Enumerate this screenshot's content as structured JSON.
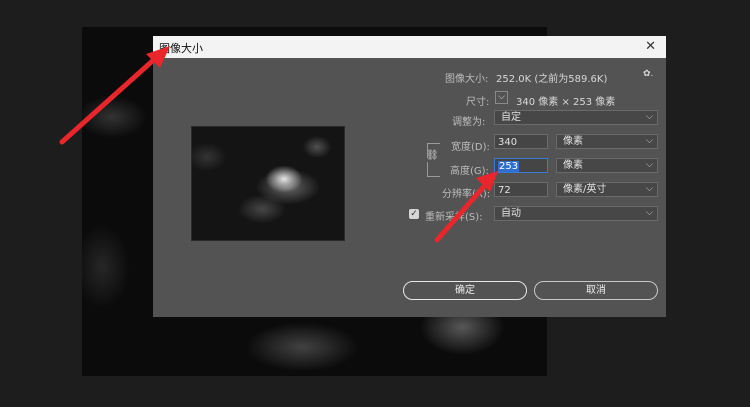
{
  "dialog": {
    "title": "图像大小",
    "image_size_label": "图像大小:",
    "image_size_value": "252.0K (之前为589.6K)",
    "dimensions_label": "尺寸:",
    "dimensions_value": "340 像素  ×  253 像素",
    "fit_to_label": "调整为:",
    "fit_to_value": "自定",
    "width_label": "宽度(D):",
    "width_value": "340",
    "width_unit": "像素",
    "height_label": "高度(G):",
    "height_value": "253",
    "height_unit": "像素",
    "resolution_label": "分辨率(R):",
    "resolution_value": "72",
    "resolution_unit": "像素/英寸",
    "resample_label": "重新采样(S):",
    "resample_value": "自动",
    "ok_label": "确定",
    "cancel_label": "取消",
    "close_glyph": "✕",
    "gear_glyph": "✿.",
    "check_glyph": "✓",
    "chevron_glyph": "⌵",
    "accent_color": "#e8262b"
  }
}
